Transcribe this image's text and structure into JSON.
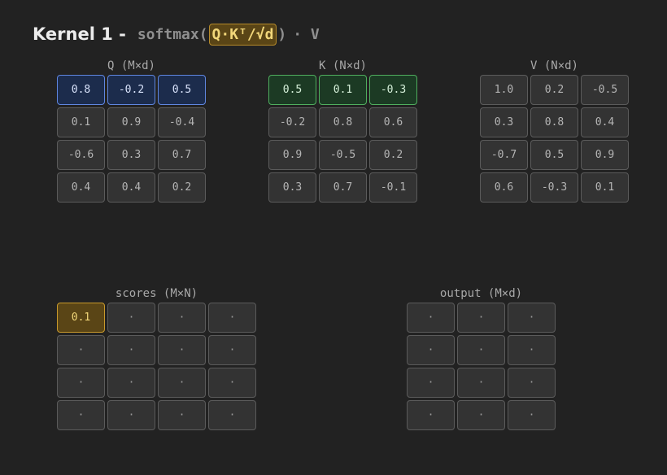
{
  "title": {
    "kernel": "Kernel 1 -",
    "pre": "softmax(",
    "highlight": "Q·Kᵀ/√d",
    "post": ")",
    "suffix": "· V"
  },
  "matrices": {
    "q": {
      "label": "Q (M×d)",
      "cols": 3,
      "cells": [
        "0.8",
        "-0.2",
        "0.5",
        "0.1",
        "0.9",
        "-0.4",
        "-0.6",
        "0.3",
        "0.7",
        "0.4",
        "0.4",
        "0.2"
      ],
      "highlight_row": 0,
      "highlight_color": "blue"
    },
    "k": {
      "label": "K (N×d)",
      "cols": 3,
      "cells": [
        "0.5",
        "0.1",
        "-0.3",
        "-0.2",
        "0.8",
        "0.6",
        "0.9",
        "-0.5",
        "0.2",
        "0.3",
        "0.7",
        "-0.1"
      ],
      "highlight_row": 0,
      "highlight_color": "green"
    },
    "v": {
      "label": "V (N×d)",
      "cols": 3,
      "cells": [
        "1.0",
        "0.2",
        "-0.5",
        "0.3",
        "0.8",
        "0.4",
        "-0.7",
        "0.5",
        "0.9",
        "0.6",
        "-0.3",
        "0.1"
      ]
    },
    "scores": {
      "label": "scores (M×N)",
      "cols": 4,
      "cells": [
        "0.1",
        "·",
        "·",
        "·",
        "·",
        "·",
        "·",
        "·",
        "·",
        "·",
        "·",
        "·",
        "·",
        "·",
        "·",
        "·"
      ],
      "highlight_cell": 0,
      "highlight_color": "gold"
    },
    "output": {
      "label": "output (M×d)",
      "cols": 3,
      "cells": [
        "·",
        "·",
        "·",
        "·",
        "·",
        "·",
        "·",
        "·",
        "·",
        "·",
        "·",
        "·"
      ]
    }
  },
  "colors": {
    "background": "#222222",
    "q_highlight": "#5f86e0",
    "k_highlight": "#4fae5e",
    "scores_highlight": "#c99a2c"
  }
}
